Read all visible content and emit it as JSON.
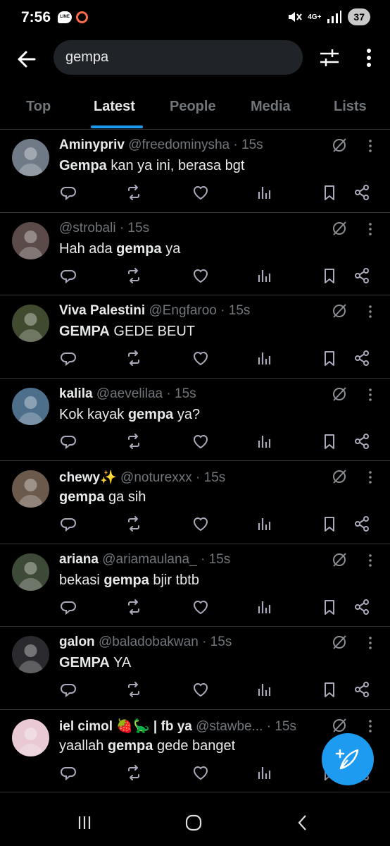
{
  "status_bar": {
    "time": "7:56",
    "line_app_label": "LINE",
    "network_type": "4G+",
    "battery_level": "37"
  },
  "search": {
    "query": "gempa"
  },
  "tabs": [
    {
      "label": "Top",
      "active": false
    },
    {
      "label": "Latest",
      "active": true
    },
    {
      "label": "People",
      "active": false
    },
    {
      "label": "Media",
      "active": false
    },
    {
      "label": "Lists",
      "active": false
    }
  ],
  "tweets": [
    {
      "name": "Aminypriv",
      "handle": "@freedominysha",
      "time": "· 15s",
      "text_pre": "",
      "text_bold": "Gempa",
      "text_post": " kan ya ini, berasa bgt",
      "avatar_color": "#6f7a86"
    },
    {
      "name": "",
      "handle": "@strobali",
      "time": "· 15s",
      "text_pre": "Hah ada ",
      "text_bold": "gempa",
      "text_post": " ya",
      "avatar_color": "#5a4a48"
    },
    {
      "name": "Viva Palestini",
      "handle": "@Engfaroo",
      "time": "· 15s",
      "text_pre": "",
      "text_bold": "GEMPA",
      "text_post": " GEDE BEUT",
      "avatar_color": "#3f4a2e"
    },
    {
      "name": "kalila",
      "handle": "@aevelilaa",
      "time": "· 15s",
      "text_pre": "Kok kayak ",
      "text_bold": "gempa",
      "text_post": " ya?",
      "avatar_color": "#4e6f8c"
    },
    {
      "name": "chewy✨",
      "handle": "@noturexxx",
      "time": "· 15s",
      "text_pre": "",
      "text_bold": "gempa",
      "text_post": " ga sih",
      "avatar_color": "#6b5a4c"
    },
    {
      "name": "ariana",
      "handle": "@ariamaulana_",
      "time": "· 15s",
      "text_pre": "bekasi ",
      "text_bold": "gempa",
      "text_post": " bjir tbtb",
      "avatar_color": "#3e4a38"
    },
    {
      "name": "galon",
      "handle": "@baladobakwan",
      "time": "· 15s",
      "text_pre": "",
      "text_bold": "GEMPA",
      "text_post": " YA",
      "avatar_color": "#2a2a2e"
    },
    {
      "name": "iel cimol 🍓🦕 | fb ya",
      "handle": "@stawbe...",
      "time": "· 15s",
      "text_pre": "yaallah ",
      "text_bold": "gempa",
      "text_post": " gede banget",
      "avatar_color": "#e8c9d4"
    }
  ],
  "icons": {
    "back": "arrow-left-icon",
    "filter": "sliders-icon",
    "more": "vertical-dots-icon",
    "grok": "grok-icon",
    "reply": "reply-icon",
    "retweet": "retweet-icon",
    "like": "heart-icon",
    "views": "views-icon",
    "bookmark": "bookmark-icon",
    "share": "share-icon",
    "compose": "compose-feather-icon"
  },
  "colors": {
    "accent": "#1d9bf0",
    "background": "#000000",
    "text": "#e7e9ea",
    "muted": "#71767b",
    "divider": "#2f3336"
  }
}
